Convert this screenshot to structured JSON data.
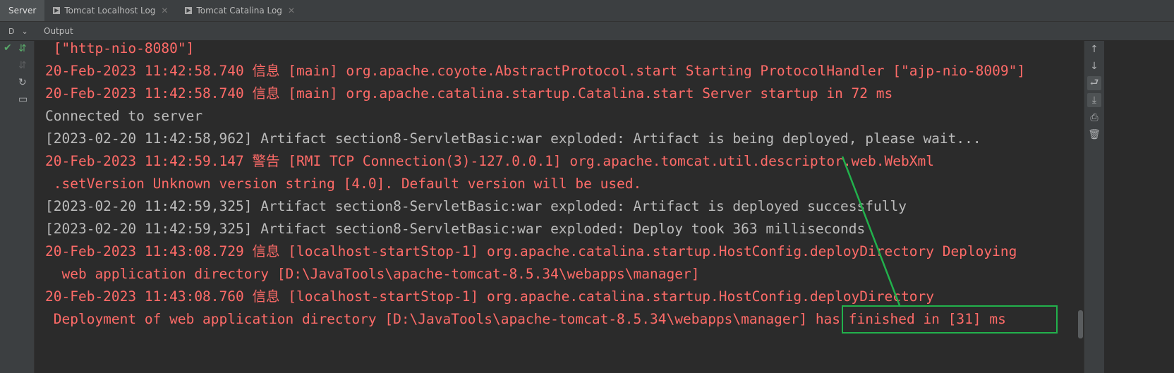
{
  "tabs": [
    {
      "label": "Server",
      "closable": false,
      "active": true
    },
    {
      "label": "Tomcat Localhost Log",
      "closable": true,
      "active": false
    },
    {
      "label": "Tomcat Catalina Log",
      "closable": true,
      "active": false
    }
  ],
  "subbar": {
    "dropdown_value": "D",
    "output_label": "Output"
  },
  "icons": {
    "check": "check-icon",
    "deploy": "deploy-icon",
    "undeploy": "undeploy-icon",
    "refresh": "refresh-icon",
    "add": "add-config-icon",
    "up": "arrow-up-icon",
    "down": "arrow-down-icon",
    "wrap": "soft-wrap-icon",
    "scroll_end": "scroll-to-end-icon",
    "print": "print-icon",
    "trash": "trash-icon"
  },
  "colors": {
    "error_text": "#ff6b68",
    "normal_text": "#bbbbbb",
    "highlight_box": "#22b14c",
    "background": "#2b2b2b"
  },
  "console_lines": [
    {
      "text": " [\"http-nio-8080\"]",
      "color": "red"
    },
    {
      "text": "20-Feb-2023 11:42:58.740 信息 [main] org.apache.coyote.AbstractProtocol.start Starting ProtocolHandler [\"ajp-nio-8009\"]",
      "color": "red"
    },
    {
      "text": "20-Feb-2023 11:42:58.740 信息 [main] org.apache.catalina.startup.Catalina.start Server startup in 72 ms",
      "color": "red"
    },
    {
      "text": "Connected to server",
      "color": "gray"
    },
    {
      "text": "[2023-02-20 11:42:58,962] Artifact section8-ServletBasic:war exploded: Artifact is being deployed, please wait...",
      "color": "gray"
    },
    {
      "text": "20-Feb-2023 11:42:59.147 警告 [RMI TCP Connection(3)-127.0.0.1] org.apache.tomcat.util.descriptor.web.WebXml",
      "color": "red"
    },
    {
      "text": " .setVersion Unknown version string [4.0]. Default version will be used.",
      "color": "red"
    },
    {
      "text": "[2023-02-20 11:42:59,325] Artifact section8-ServletBasic:war exploded: Artifact is deployed successfully",
      "color": "gray"
    },
    {
      "text": "[2023-02-20 11:42:59,325] Artifact section8-ServletBasic:war exploded: Deploy took 363 milliseconds",
      "color": "gray"
    },
    {
      "text": "20-Feb-2023 11:43:08.729 信息 [localhost-startStop-1] org.apache.catalina.startup.HostConfig.deployDirectory Deploying",
      "color": "red"
    },
    {
      "text": "  web application directory [D:\\JavaTools\\apache-tomcat-8.5.34\\webapps\\manager]",
      "color": "red"
    },
    {
      "text": "20-Feb-2023 11:43:08.760 信息 [localhost-startStop-1] org.apache.catalina.startup.HostConfig.deployDirectory",
      "color": "red"
    },
    {
      "text": " Deployment of web application directory [D:\\JavaTools\\apache-tomcat-8.5.34\\webapps\\manager] has finished in [31] ms",
      "color": "red"
    }
  ]
}
